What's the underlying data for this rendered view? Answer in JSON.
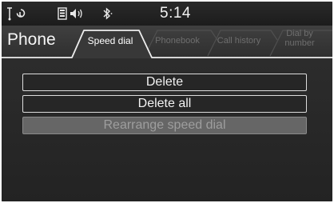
{
  "status_bar": {
    "time": "5:14",
    "icons": [
      "signal-strength-icon",
      "handsfree-phone-icon",
      "phone-battery-icon",
      "audio-volume-icon",
      "bluetooth-icon"
    ]
  },
  "header": {
    "title": "Phone",
    "tabs": [
      {
        "label": "Speed dial",
        "active": true
      },
      {
        "label": "Phonebook",
        "active": false
      },
      {
        "label": "Call history",
        "active": false
      },
      {
        "label_line1": "Dial by",
        "label_line2": "number",
        "active": false
      }
    ]
  },
  "menu": {
    "items": [
      {
        "label": "Delete",
        "enabled": true
      },
      {
        "label": "Delete all",
        "enabled": true
      },
      {
        "label": "Rearrange speed dial",
        "enabled": true,
        "highlighted": true
      }
    ]
  },
  "colors": {
    "background": "#262626",
    "text": "#f2f2f2",
    "tab_inactive_text": "#6e6e6e",
    "highlight": "#666666"
  }
}
